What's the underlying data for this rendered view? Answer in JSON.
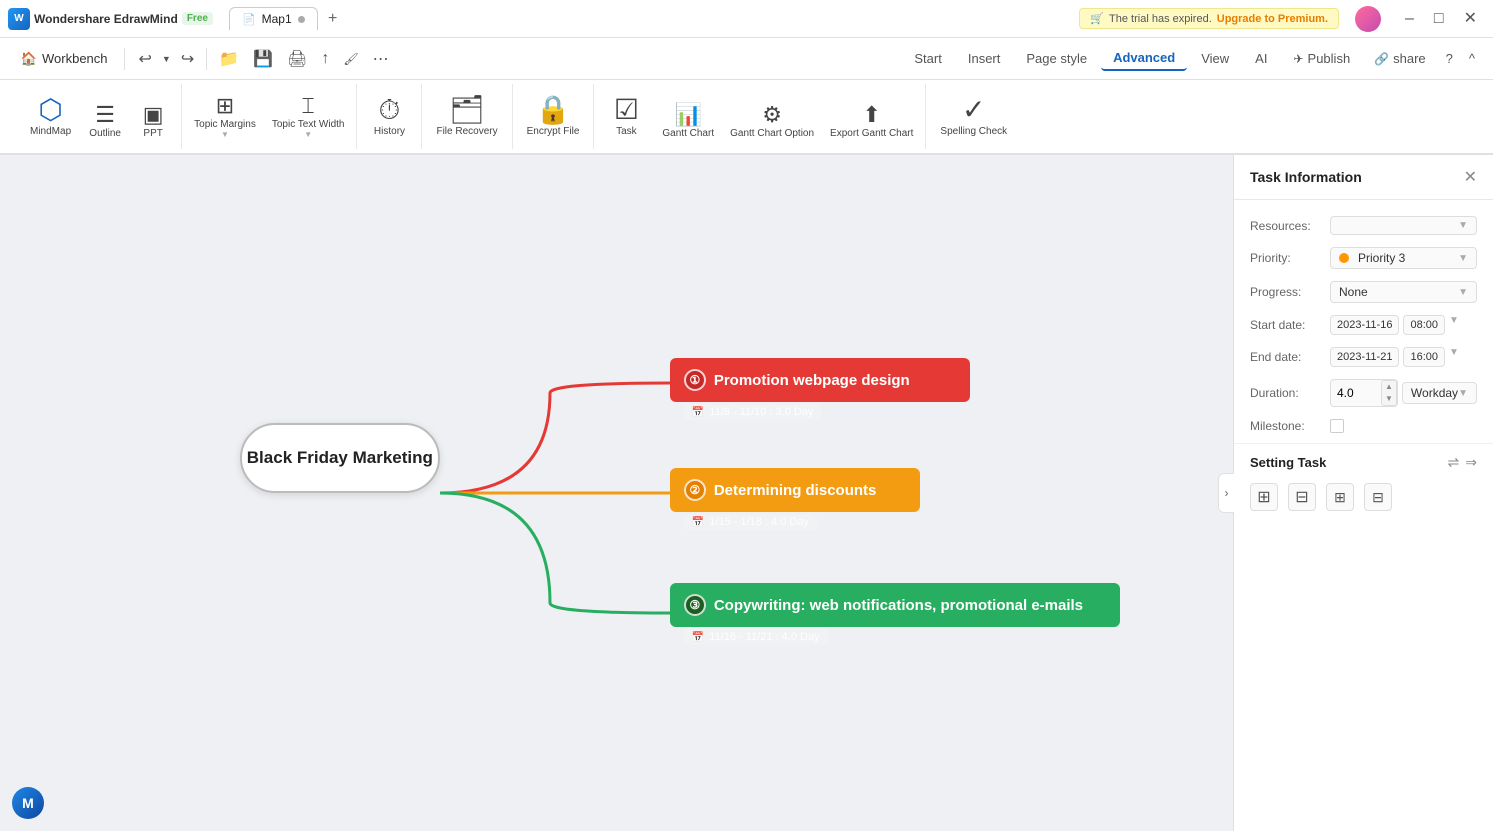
{
  "app": {
    "name": "Wondershare EdrawMind",
    "badge": "Free",
    "tab1_label": "Map1",
    "tab1_icon": "📄",
    "add_tab_label": "+",
    "trial_text": "The trial has expired.",
    "upgrade_text": "Upgrade to Premium.",
    "win_minimize": "–",
    "win_maximize": "□",
    "win_close": "✕"
  },
  "toolbar": {
    "workbench_label": "Workbench",
    "undo_label": "↩",
    "redo_label": "↪",
    "open_label": "📂",
    "print_label": "🖨",
    "export_label": "↑",
    "more_label": "…"
  },
  "nav": {
    "items": [
      {
        "id": "start",
        "label": "Start"
      },
      {
        "id": "insert",
        "label": "Insert"
      },
      {
        "id": "page_style",
        "label": "Page style"
      },
      {
        "id": "advanced",
        "label": "Advanced",
        "active": true
      },
      {
        "id": "view",
        "label": "View"
      },
      {
        "id": "ai",
        "label": "AI"
      }
    ],
    "publish_label": "Publish",
    "share_label": "share",
    "help_label": "?",
    "collapse_label": "^"
  },
  "ribbon": {
    "groups": [
      {
        "id": "view_modes",
        "items": [
          {
            "id": "mindmap",
            "icon": "⬡",
            "label": "MindMap",
            "active": true
          },
          {
            "id": "outline",
            "icon": "☰",
            "label": "Outline"
          },
          {
            "id": "ppt",
            "icon": "▣",
            "label": "PPT"
          }
        ]
      },
      {
        "id": "topic",
        "items": [
          {
            "id": "topic_margins",
            "icon": "⊞",
            "label": "Topic Margins"
          },
          {
            "id": "topic_text_width",
            "icon": "⌶",
            "label": "Topic Text Width"
          }
        ]
      },
      {
        "id": "history",
        "items": [
          {
            "id": "history",
            "icon": "⏱",
            "label": "History"
          }
        ]
      },
      {
        "id": "file",
        "items": [
          {
            "id": "file_recovery",
            "icon": "🗂",
            "label": "File Recovery"
          }
        ]
      },
      {
        "id": "encrypt",
        "items": [
          {
            "id": "encrypt_file",
            "icon": "🔒",
            "label": "Encrypt File"
          }
        ]
      },
      {
        "id": "task_gantt",
        "items": [
          {
            "id": "task",
            "icon": "☑",
            "label": "Task"
          },
          {
            "id": "gantt_chart",
            "icon": "📊",
            "label": "Gantt Chart"
          },
          {
            "id": "gantt_chart_option",
            "icon": "⚙",
            "label": "Gantt Chart Option"
          },
          {
            "id": "export_gantt_chart",
            "icon": "⬆",
            "label": "Export Gantt Chart"
          }
        ]
      },
      {
        "id": "spell",
        "items": [
          {
            "id": "spelling_check",
            "icon": "✓",
            "label": "Spelling Check"
          }
        ]
      }
    ]
  },
  "mindmap": {
    "central_node": "Black Friday Marketing",
    "branches": [
      {
        "id": "branch1",
        "number": "①",
        "label": "Promotion webpage design",
        "color": "red",
        "date_range": "11/8 - 11/10 : 3.0 Day"
      },
      {
        "id": "branch2",
        "number": "②",
        "label": "Determining discounts",
        "color": "orange",
        "date_range": "1/15 - 1/18 : 4.0 Day"
      },
      {
        "id": "branch3",
        "number": "③",
        "label": "Copywriting: web notifications, promotional e-mails",
        "color": "green",
        "date_range": "11/16 - 11/21 : 4.0 Day"
      }
    ]
  },
  "task_panel": {
    "title": "Task Information",
    "fields": {
      "resources_label": "Resources:",
      "resources_value": "",
      "priority_label": "Priority:",
      "priority_value": "Priority 3",
      "progress_label": "Progress:",
      "progress_value": "None",
      "start_date_label": "Start date:",
      "start_date_value": "2023-11-16",
      "start_time_value": "08:00",
      "end_date_label": "End date:",
      "end_date_value": "2023-11-21",
      "end_time_value": "16:00",
      "duration_label": "Duration:",
      "duration_value": "4.0",
      "duration_unit": "Workday",
      "milestone_label": "Milestone:"
    },
    "setting_task_label": "Setting Task",
    "setting_icons": [
      {
        "id": "add",
        "icon": "⊞"
      },
      {
        "id": "remove",
        "icon": "⊟"
      },
      {
        "id": "grid1",
        "icon": "⊞"
      },
      {
        "id": "grid2",
        "icon": "⊟"
      }
    ]
  },
  "bottom_logo": "M"
}
